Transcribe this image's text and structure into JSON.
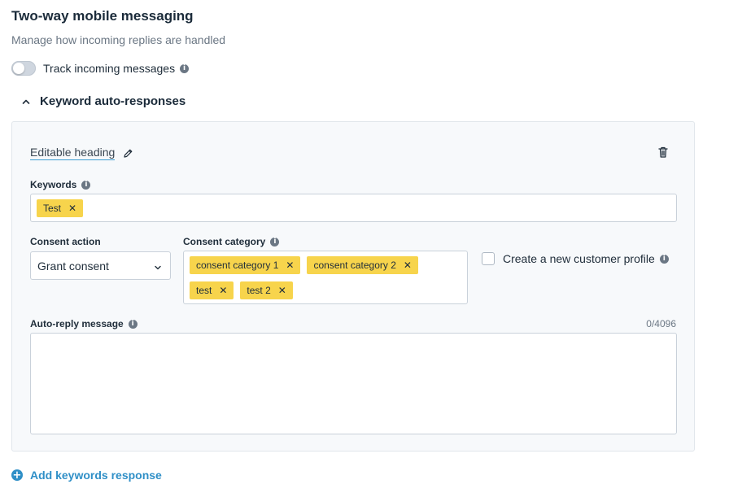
{
  "header": {
    "title": "Two-way mobile messaging",
    "subtitle": "Manage how incoming replies are handled"
  },
  "tracking": {
    "label": "Track incoming messages",
    "enabled": false
  },
  "section": {
    "title": "Keyword auto-responses",
    "expanded": true
  },
  "card": {
    "heading": "Editable heading",
    "keywords": {
      "label": "Keywords",
      "tags": [
        "Test"
      ]
    },
    "consent_action": {
      "label": "Consent action",
      "value": "Grant consent"
    },
    "consent_category": {
      "label": "Consent category",
      "tags": [
        "consent category 1",
        "consent category 2",
        "test",
        "test 2"
      ]
    },
    "create_profile": {
      "label": "Create a new customer profile",
      "checked": false
    },
    "auto_reply": {
      "label": "Auto-reply message",
      "value": "",
      "counter": "0/4096"
    }
  },
  "add_button": {
    "label": "Add keywords response"
  },
  "colors": {
    "tag": "#f7d44c",
    "accent": "#2f8fc7",
    "card_bg": "#f7f9fb"
  }
}
